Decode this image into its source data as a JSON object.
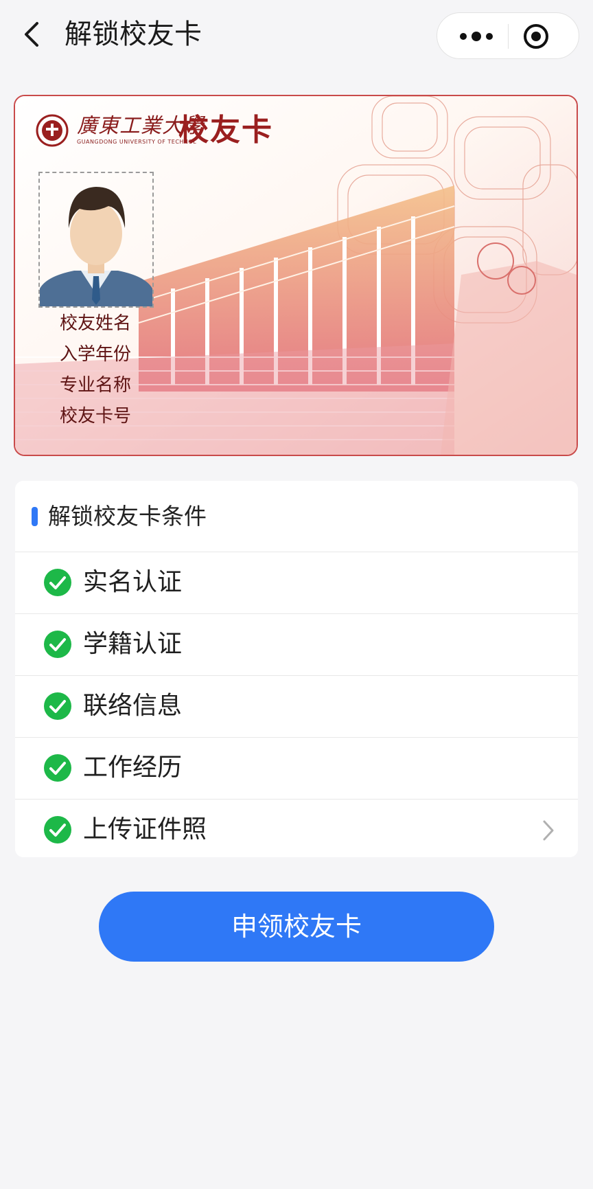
{
  "nav": {
    "title": "解锁校友卡",
    "back_icon": "chevron-left-icon",
    "more_icon": "more-dots-icon",
    "close_icon": "target-circle-icon"
  },
  "card": {
    "school_name": "廣東工業大學",
    "school_name_en": "GUANGDONG UNIVERSITY OF TECHNOL",
    "title": "校友卡",
    "fields": [
      "校友姓名",
      "入学年份",
      "专业名称",
      "校友卡号"
    ],
    "colors": {
      "brand": "#9a1f1f",
      "border": "#c94a4a"
    }
  },
  "conditions": {
    "title": "解锁校友卡条件",
    "accent": "#2f78f6",
    "check_color": "#1db848",
    "items": [
      {
        "label": "实名认证",
        "done": true
      },
      {
        "label": "学籍认证",
        "done": true
      },
      {
        "label": "联络信息",
        "done": true
      },
      {
        "label": "工作经历",
        "done": true
      },
      {
        "label": "上传证件照",
        "done": true,
        "has_arrow": true
      }
    ]
  },
  "apply_button": {
    "label": "申领校友卡",
    "color": "#2f78f6"
  }
}
